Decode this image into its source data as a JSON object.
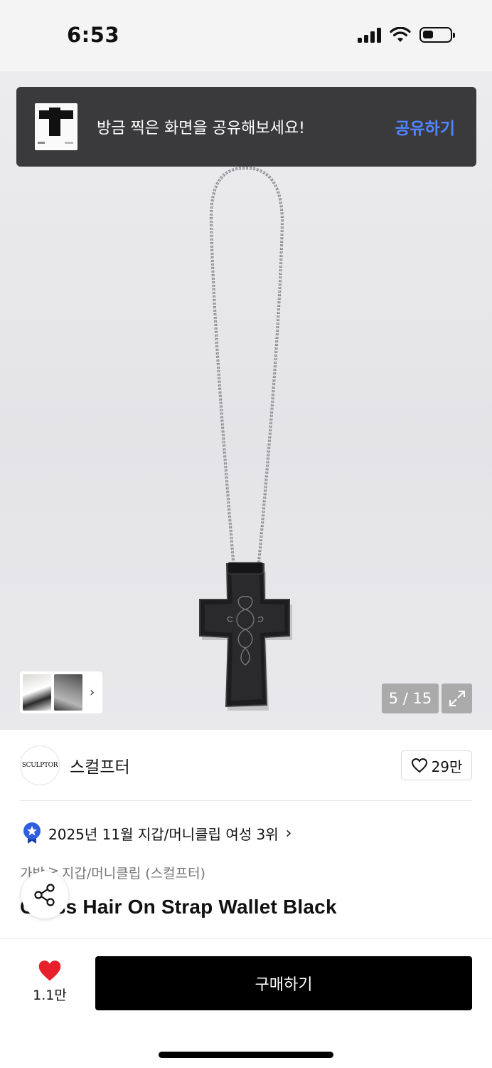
{
  "status_bar": {
    "time": "6:53"
  },
  "toast": {
    "message": "방금 찍은 화면을 공유해보세요!",
    "action": "공유하기"
  },
  "gallery": {
    "counter": "5 / 15"
  },
  "brand": {
    "logo_text": "SCULPTOR",
    "name": "스컬프터",
    "likes": "29만"
  },
  "ranking": {
    "text": "2025년 11월 지갑/머니클립 여성 3위"
  },
  "breadcrumb": {
    "parent": "가방",
    "separator": ">",
    "current": "지갑/머니클립 (스컬프터)"
  },
  "product": {
    "title": "Cross Hair On Strap Wallet Black"
  },
  "bottom": {
    "wish_count": "1.1만",
    "buy_label": "구매하기"
  },
  "colors": {
    "accent_blue": "#4f86ff",
    "heart_red": "#e8202a",
    "badge_blue": "#2f5fe0"
  }
}
